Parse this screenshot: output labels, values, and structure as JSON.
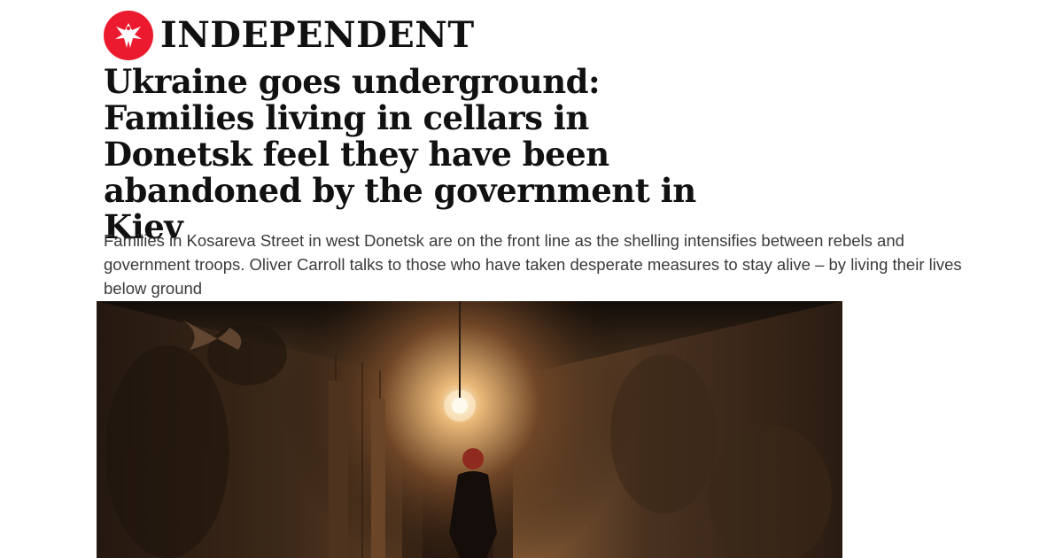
{
  "masthead": {
    "brand_name": "INDEPENDENT",
    "logo_icon": "eagle-icon",
    "logo_color": "#ec1a2e"
  },
  "article": {
    "headline": "Ukraine goes underground: Families living in cellars in Donetsk feel they have been abandoned by the government in Kiev",
    "standfirst": "Families in Kosareva Street in west Donetsk are on the front line as the shelling intensifies between rebels and government troops. Oliver Carroll talks to those who have taken desperate measures to stay alive – by living their lives below ground"
  },
  "hero_image": {
    "icon": "cellar-corridor-photo"
  }
}
